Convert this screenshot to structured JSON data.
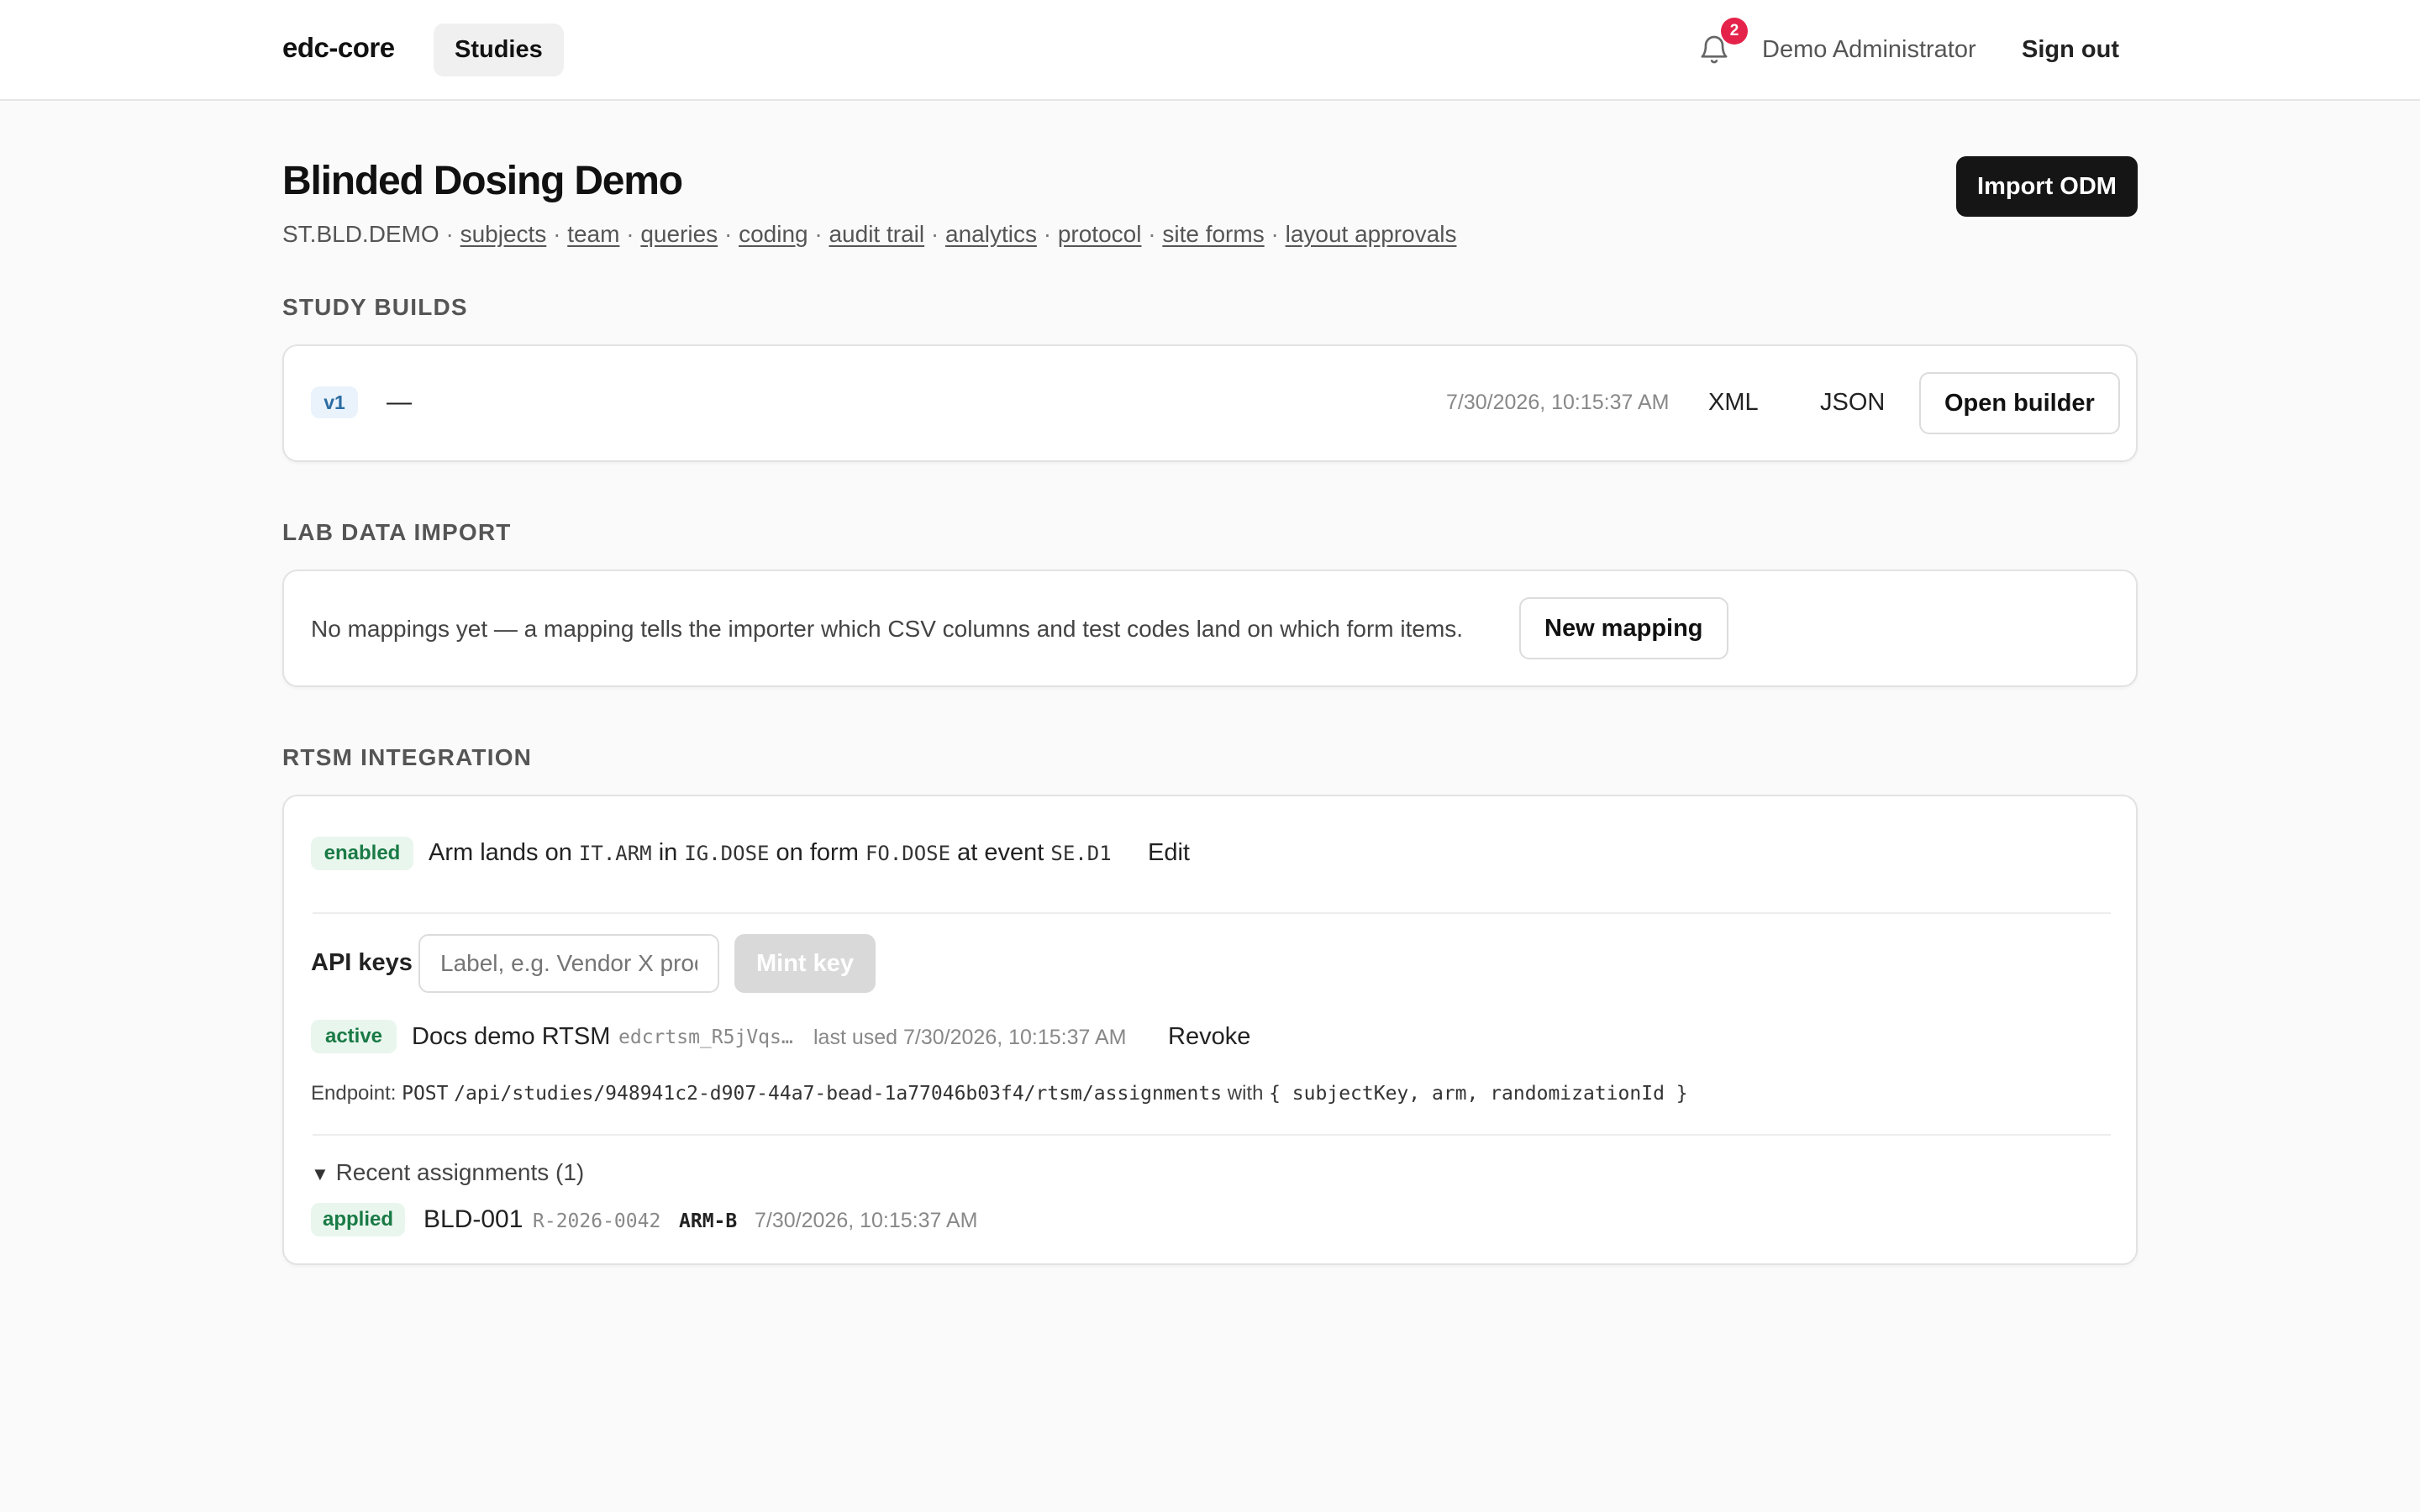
{
  "header": {
    "brand": "edc-core",
    "nav_studies": "Studies",
    "notification_count": "2",
    "user_name": "Demo Administrator",
    "sign_out": "Sign out"
  },
  "study": {
    "title": "Blinded Dosing Demo",
    "code": "ST.BLD.DEMO",
    "links": [
      "subjects",
      "team",
      "queries",
      "coding",
      "audit trail",
      "analytics",
      "protocol",
      "site forms",
      "layout approvals"
    ],
    "import_button": "Import ODM"
  },
  "builds": {
    "label": "STUDY BUILDS",
    "version": "v1",
    "description": "—",
    "timestamp": "7/30/2026, 10:15:37 AM",
    "xml": "XML",
    "json": "JSON",
    "open_builder": "Open builder"
  },
  "lab": {
    "label": "LAB DATA IMPORT",
    "empty_text": "No mappings yet — a mapping tells the importer which CSV columns and test codes land on which form items.",
    "new_mapping": "New mapping"
  },
  "rtsm": {
    "label": "RTSM INTEGRATION",
    "status": "enabled",
    "arm_lands_on": "Arm lands on",
    "item": "IT.ARM",
    "in": "in",
    "group": "IG.DOSE",
    "on_form": "on form",
    "form": "FO.DOSE",
    "at_event": "at event",
    "event": "SE.D1",
    "edit": "Edit",
    "api_keys_label": "API keys",
    "key_placeholder": "Label, e.g. Vendor X prod",
    "mint_key": "Mint key",
    "key_status": "active",
    "key_name": "Docs demo RTSM",
    "key_prefix": "edcrtsm_R5jVqs…",
    "key_last_used": "last used 7/30/2026, 10:15:37 AM",
    "revoke": "Revoke",
    "endpoint_label": "Endpoint:",
    "endpoint_method": "POST",
    "endpoint_path": "/api/studies/948941c2-d907-44a7-bead-1a77046b03f4/rtsm/assignments",
    "endpoint_with": "with",
    "endpoint_body": "{ subjectKey, arm, randomizationId }",
    "recent_summary": "Recent assignments (1)",
    "assignment": {
      "status": "applied",
      "subject": "BLD-001",
      "randomization_id": "R-2026-0042",
      "arm": "ARM-B",
      "timestamp": "7/30/2026, 10:15:37 AM"
    }
  }
}
